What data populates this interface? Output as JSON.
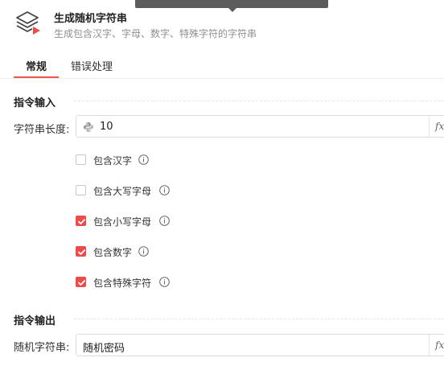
{
  "header": {
    "title": "生成随机字符串",
    "description": "生成包含汉字、字母、数字、特殊字符的字符串",
    "icon": "layers-stack-icon"
  },
  "tabs": [
    {
      "label": "常规",
      "active": true
    },
    {
      "label": "错误处理",
      "active": false
    }
  ],
  "input_section": {
    "title": "指令输入",
    "length_field": {
      "label": "字符串长度:",
      "value": "10",
      "icon": "python-icon",
      "fx": "fx"
    },
    "options": [
      {
        "label": "包含汉字",
        "checked": false
      },
      {
        "label": "包含大写字母",
        "checked": false
      },
      {
        "label": "包含小写字母",
        "checked": true
      },
      {
        "label": "包含数字",
        "checked": true
      },
      {
        "label": "包含特殊字符",
        "checked": true
      }
    ]
  },
  "output_section": {
    "title": "指令输出",
    "result_field": {
      "label": "随机字符串:",
      "value": "随机密码",
      "fx": "fx"
    }
  },
  "colors": {
    "accent": "#ef4b49",
    "tab_underline": "#e8584e"
  }
}
